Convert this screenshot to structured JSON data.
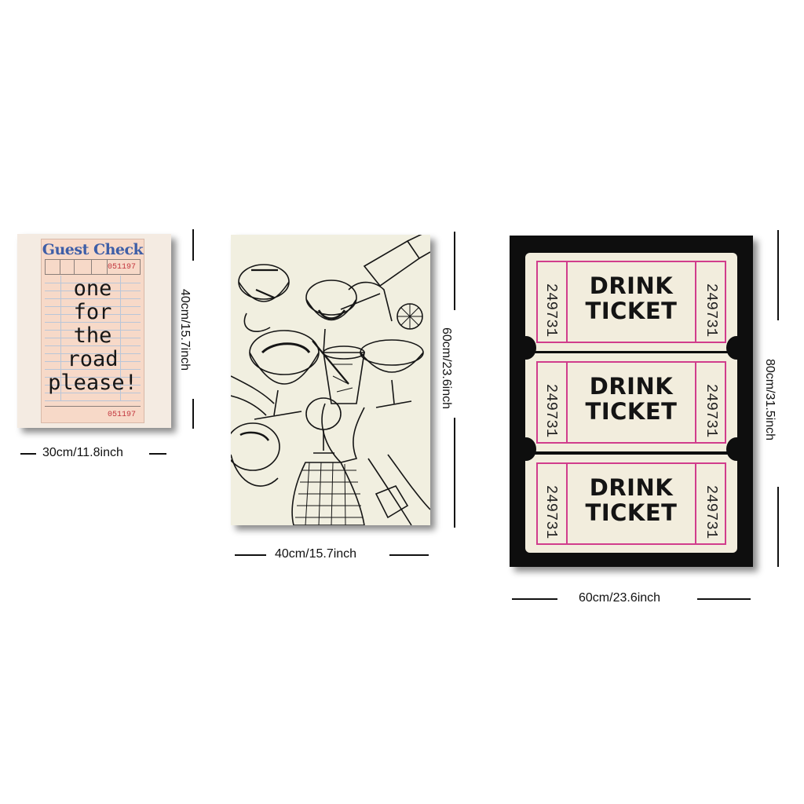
{
  "posters": [
    {
      "title": "Guest Check",
      "number": "051197",
      "footer_number": "051197",
      "handwriting": [
        "one",
        "for",
        "the",
        "road",
        "please!"
      ],
      "width_label": "30cm/11.8inch",
      "height_label": "40cm/15.7inch"
    },
    {
      "width_label": "40cm/15.7inch",
      "height_label": "60cm/23.6inch"
    },
    {
      "ticket_label_line1": "DRINK",
      "ticket_label_line2": "TICKET",
      "ticket_number": "249731",
      "width_label": "60cm/23.6inch",
      "height_label": "80cm/31.5inch"
    }
  ],
  "colors": {
    "check_title": "#3e5ea7",
    "check_number": "#c2363e",
    "ticket_border": "#d13d8c",
    "ticket_background": "#0e0e0e"
  }
}
